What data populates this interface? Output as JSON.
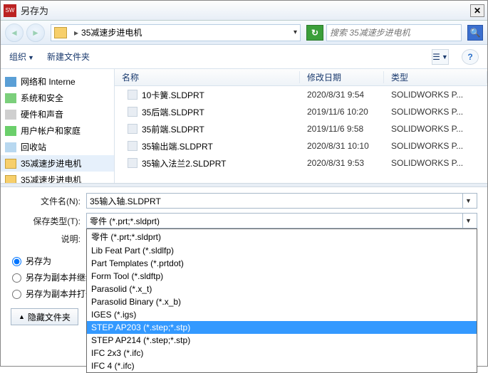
{
  "window": {
    "title": "另存为"
  },
  "nav": {
    "breadcrumb": "35减速步进电机",
    "search_placeholder": "搜索 35减速步进电机"
  },
  "toolbar": {
    "organize": "组织",
    "new_folder": "新建文件夹"
  },
  "tree": {
    "items": [
      {
        "icon": "network",
        "label": "网络和 Interne"
      },
      {
        "icon": "sys",
        "label": "系统和安全"
      },
      {
        "icon": "hw",
        "label": "硬件和声音"
      },
      {
        "icon": "user",
        "label": "用户帐户和家庭"
      },
      {
        "icon": "recycle",
        "label": "回收站"
      },
      {
        "icon": "folder",
        "label": "35减速步进电机",
        "selected": true
      },
      {
        "icon": "folder",
        "label": "35减速步进电机"
      }
    ]
  },
  "columns": {
    "name": "名称",
    "date": "修改日期",
    "type": "类型"
  },
  "files": [
    {
      "name": "10卡簧.SLDPRT",
      "date": "2020/8/31 9:54",
      "type": "SOLIDWORKS P..."
    },
    {
      "name": "35后端.SLDPRT",
      "date": "2019/11/6 10:20",
      "type": "SOLIDWORKS P..."
    },
    {
      "name": "35前端.SLDPRT",
      "date": "2019/11/6 9:58",
      "type": "SOLIDWORKS P..."
    },
    {
      "name": "35输出端.SLDPRT",
      "date": "2020/8/31 10:10",
      "type": "SOLIDWORKS P..."
    },
    {
      "name": "35输入法兰2.SLDPRT",
      "date": "2020/8/31 9:53",
      "type": "SOLIDWORKS P..."
    }
  ],
  "form": {
    "filename_label": "文件名(N):",
    "filename_value": "35输入轴.SLDPRT",
    "filetype_label": "保存类型(T):",
    "filetype_value": "零件 (*.prt;*.sldprt)",
    "desc_label": "说明:",
    "options": [
      "零件 (*.prt;*.sldprt)",
      "Lib Feat Part (*.sldlfp)",
      "Part Templates (*.prtdot)",
      "Form Tool (*.sldftp)",
      "Parasolid (*.x_t)",
      "Parasolid Binary (*.x_b)",
      "IGES (*.igs)",
      "STEP AP203 (*.step;*.stp)",
      "STEP AP214 (*.step;*.stp)",
      "IFC 2x3 (*.ifc)",
      "IFC 4 (*.ifc)"
    ],
    "highlight_index": 7
  },
  "radios": {
    "r1": "另存为",
    "r2": "另存为副本并继续",
    "r3": "另存为副本并打开"
  },
  "hide_folders": "隐藏文件夹"
}
